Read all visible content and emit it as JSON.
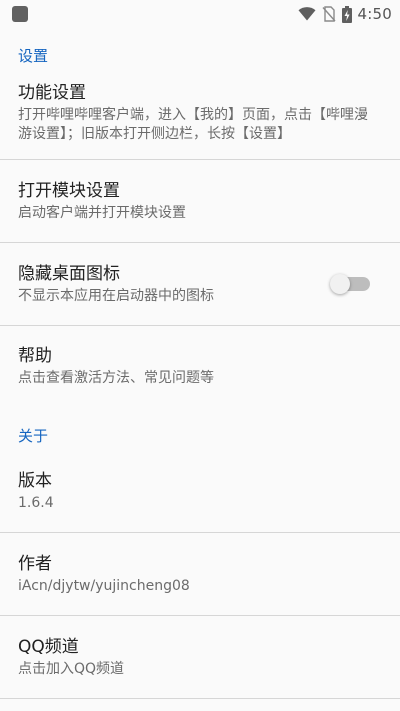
{
  "status_bar": {
    "time": "4:50",
    "icons": [
      "app-notification-icon",
      "wifi-icon",
      "no-sim-icon",
      "battery-charging-icon"
    ]
  },
  "settings_category": "设置",
  "settings": [
    {
      "title": "功能设置",
      "summary": "打开哔哩哔哩客户端，进入【我的】页面，点击【哔哩漫游设置】；旧版本打开侧边栏，长按【设置】"
    },
    {
      "title": "打开模块设置",
      "summary": "启动客户端并打开模块设置"
    },
    {
      "title": "隐藏桌面图标",
      "summary": "不显示本应用在启动器中的图标",
      "switch": false
    },
    {
      "title": "帮助",
      "summary": "点击查看激活方法、常见问题等"
    }
  ],
  "about_category": "关于",
  "about": [
    {
      "title": "版本",
      "summary": "1.6.4"
    },
    {
      "title": "作者",
      "summary": "iAcn/djytw/yujincheng08"
    },
    {
      "title": "QQ频道",
      "summary": "点击加入QQ频道"
    }
  ],
  "colors": {
    "accent": "#1565c0",
    "background": "#fafafa",
    "divider": "#d6d6d6",
    "switch_track_off": "#bdbdbd"
  }
}
